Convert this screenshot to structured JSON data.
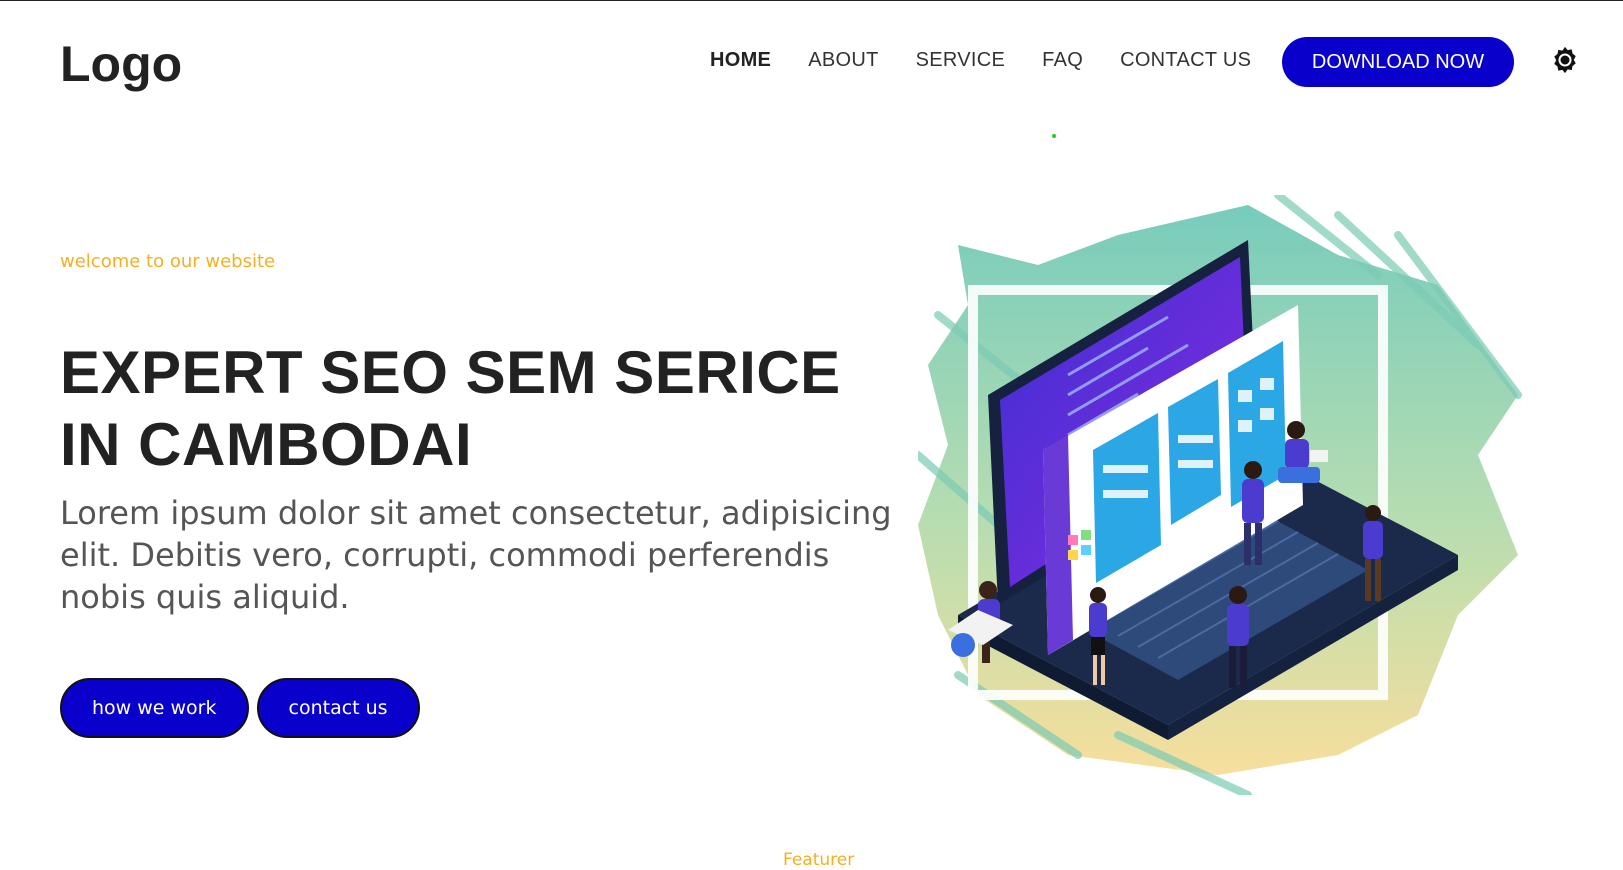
{
  "header": {
    "logo": "Logo",
    "nav": [
      {
        "label": "HOME",
        "active": true
      },
      {
        "label": "ABOUT",
        "active": false
      },
      {
        "label": "SERVICE",
        "active": false
      },
      {
        "label": "FAQ",
        "active": false
      },
      {
        "label": "CONTACT US",
        "active": false
      }
    ],
    "download_label": "DOWNLOAD NOW",
    "settings_icon": "gear-icon"
  },
  "hero": {
    "welcome": "welcome to our website",
    "title_line1": "EXPERT SEO SEM SERICE",
    "title_line2": "IN CAMBODAI",
    "description": "Lorem ipsum dolor sit amet consectetur, adipisicing elit. Debitis vero, corrupti, commodi perferendis nobis quis aliquid.",
    "buttons": {
      "how_we_work": "how we work",
      "contact_us": "contact us"
    },
    "illustration_icon": "isometric-laptop-team-illustration"
  },
  "section": {
    "featurer": "Featurer"
  },
  "colors": {
    "accent_blue": "#0a00cc",
    "accent_yellow": "#f5b020",
    "text_dark": "#222222",
    "text_muted": "#555555"
  }
}
